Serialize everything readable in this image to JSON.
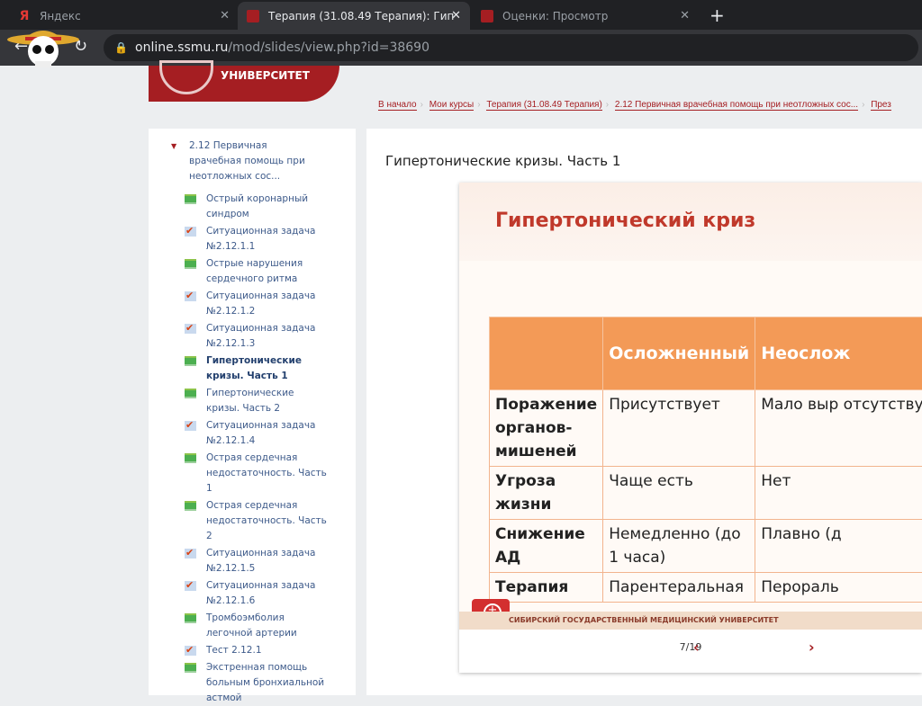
{
  "browser": {
    "tabs": [
      {
        "label": "Яндекс",
        "icon": "yandex-icon",
        "active": false
      },
      {
        "label": "Терапия (31.08.49 Терапия): Гип",
        "icon": "ssmu-icon",
        "active": true
      },
      {
        "label": "Оценки: Просмотр",
        "icon": "ssmu-icon",
        "active": false
      }
    ],
    "url_host": "online.ssmu.ru",
    "url_path": "/mod/slides/view.php?id=38690"
  },
  "header": {
    "logo_text": "УНИВЕРСИТЕТ"
  },
  "breadcrumb": [
    "В начало",
    "Мои курсы",
    "Терапия (31.08.49 Терапия)",
    "2.12 Первичная врачебная помощь при неотложных сос...",
    "През"
  ],
  "sidebar": {
    "section": "2.12 Первичная врачебная помощь при неотложных сос...",
    "items": [
      {
        "label": "Острый коронарный синдром",
        "type": "slides"
      },
      {
        "label": "Ситуационная задача №2.12.1.1",
        "type": "quiz"
      },
      {
        "label": "Острые нарушения сердечного ритма",
        "type": "slides"
      },
      {
        "label": "Ситуационная задача №2.12.1.2",
        "type": "quiz"
      },
      {
        "label": "Ситуационная задача №2.12.1.3",
        "type": "quiz"
      },
      {
        "label": "Гипертонические кризы. Часть 1",
        "type": "slides",
        "current": true
      },
      {
        "label": "Гипертонические кризы. Часть 2",
        "type": "slides"
      },
      {
        "label": "Ситуационная задача №2.12.1.4",
        "type": "quiz"
      },
      {
        "label": "Острая сердечная недостаточность. Часть 1",
        "type": "slides"
      },
      {
        "label": "Острая сердечная недостаточность. Часть 2",
        "type": "slides"
      },
      {
        "label": "Ситуационная задача №2.12.1.5",
        "type": "quiz"
      },
      {
        "label": "Ситуационная задача №2.12.1.6",
        "type": "quiz"
      },
      {
        "label": "Тромбоэмболия легочной артерии",
        "type": "slides"
      },
      {
        "label": "Тест 2.12.1",
        "type": "quiz"
      },
      {
        "label": "Экстренная помощь больным бронхиальной астмой",
        "type": "slides"
      }
    ]
  },
  "main": {
    "title": "Гипертонические кризы. Часть 1",
    "slide": {
      "title": "Гипертонический криз",
      "table": {
        "headers": [
          "",
          "Осложненный",
          "Неослож"
        ],
        "rows": [
          [
            "Поражение органов- мишеней",
            "Присутствует",
            "Мало выр отсутствуе"
          ],
          [
            "Угроза жизни",
            "Чаще есть",
            "Нет"
          ],
          [
            "Снижение АД",
            "Немедленно (до 1 часа)",
            "Плавно (д"
          ],
          [
            "Терапия",
            "Парентеральная",
            "Перораль"
          ]
        ]
      },
      "footer": "СИБИРСКИЙ ГОСУДАРСТВЕННЫЙ МЕДИЦИНСКИЙ УНИВЕРСИТЕТ"
    },
    "pager": {
      "text": "7/19",
      "prev": "‹",
      "next": "›"
    }
  }
}
